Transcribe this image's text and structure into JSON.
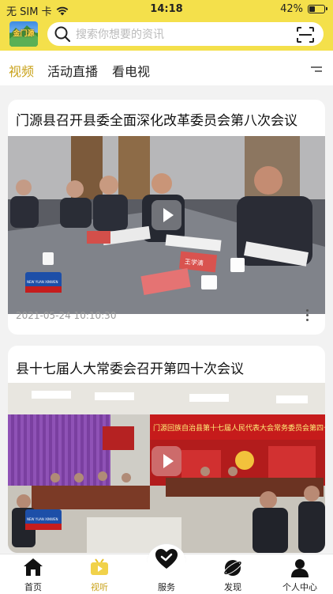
{
  "status_bar": {
    "carrier": "无 SIM 卡",
    "time": "14:18",
    "battery": "42%",
    "battery_level": 0.42
  },
  "header": {
    "logo_text": "金门源",
    "search_placeholder": "搜索你想要的资讯"
  },
  "tabs": [
    {
      "label": "视频",
      "active": true
    },
    {
      "label": "活动直播",
      "active": false
    },
    {
      "label": "看电视",
      "active": false
    }
  ],
  "videos": [
    {
      "title": "门源县召开县委全面深化改革委员会第八次会议",
      "date": "2021-05-24 10:10:30",
      "channel_badge": "NEW YUAN XINWEN",
      "nameplate": "王学清"
    },
    {
      "title": "县十七届人大常委会召开第四十次会议",
      "date": "",
      "channel_badge": "NEW YUAN XINWEN",
      "banner": "门源回族自治县第十七届人民代表大会常务委员会第四十"
    }
  ],
  "bottom_nav": [
    {
      "label": "首页",
      "icon": "home-icon",
      "active": false
    },
    {
      "label": "视听",
      "icon": "tv-icon",
      "active": true
    },
    {
      "label": "服务",
      "icon": "heart-icon",
      "active": false
    },
    {
      "label": "发现",
      "icon": "planet-icon",
      "active": false
    },
    {
      "label": "个人中心",
      "icon": "person-icon",
      "active": false
    }
  ],
  "colors": {
    "brand_yellow": "#f4e04b",
    "active_tab": "#c9a21a",
    "banner_red": "#c61b1b"
  }
}
